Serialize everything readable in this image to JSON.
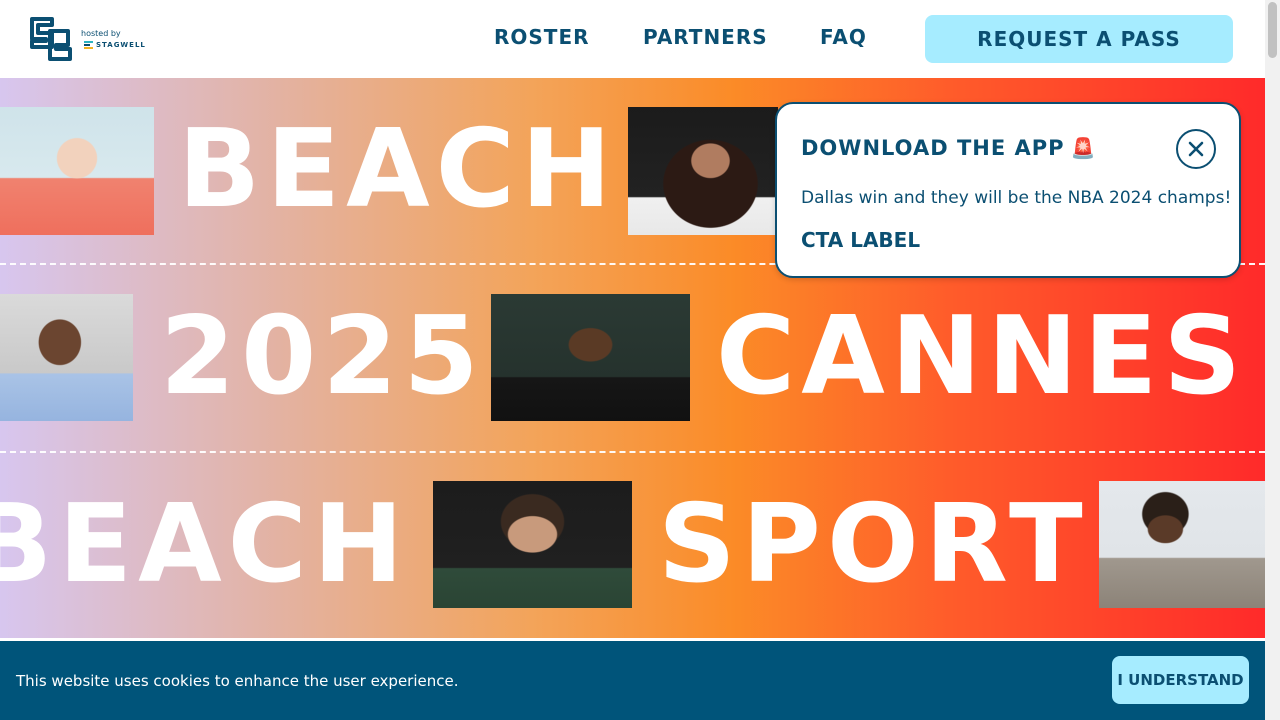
{
  "header": {
    "hosted_by": "hosted by",
    "stagwell": "STAGWELL",
    "nav": [
      {
        "label": "ROSTER"
      },
      {
        "label": "PARTNERS"
      },
      {
        "label": "FAQ"
      }
    ],
    "cta": "REQUEST A PASS"
  },
  "hero": {
    "words": [
      "BEACH",
      "2025",
      "CANNES",
      "BEACH",
      "SPORT"
    ]
  },
  "popup": {
    "title": "DOWNLOAD THE APP",
    "icon": "siren-icon",
    "text": "Dallas win and they will be the NBA 2024 champs!",
    "cta": "CTA LABEL"
  },
  "cookie": {
    "text": "This website uses cookies to enhance the user experience.",
    "button": "I UNDERSTAND"
  },
  "colors": {
    "brand_navy": "#0b4f72",
    "cta_light_blue": "#a6ecff",
    "cookie_bg": "#00547a"
  }
}
